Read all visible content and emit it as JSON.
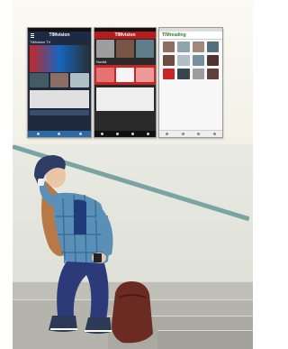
{
  "screenshots": [
    {
      "appbar_title": "TIMvision",
      "section_label": "TIMvision TV"
    },
    {
      "appbar_title": "TIMvision",
      "section_label": "Novità"
    },
    {
      "appbar_title": "TIMreading",
      "section_label": ""
    }
  ],
  "colors": {
    "wall": "#f1efe4",
    "railing": "#7aa4a2",
    "shirt": "#5a8fb8",
    "pants": "#2c3a7a",
    "hat": "#2f3c63",
    "hair": "#b77a46",
    "backpack": "#6b2a22"
  }
}
